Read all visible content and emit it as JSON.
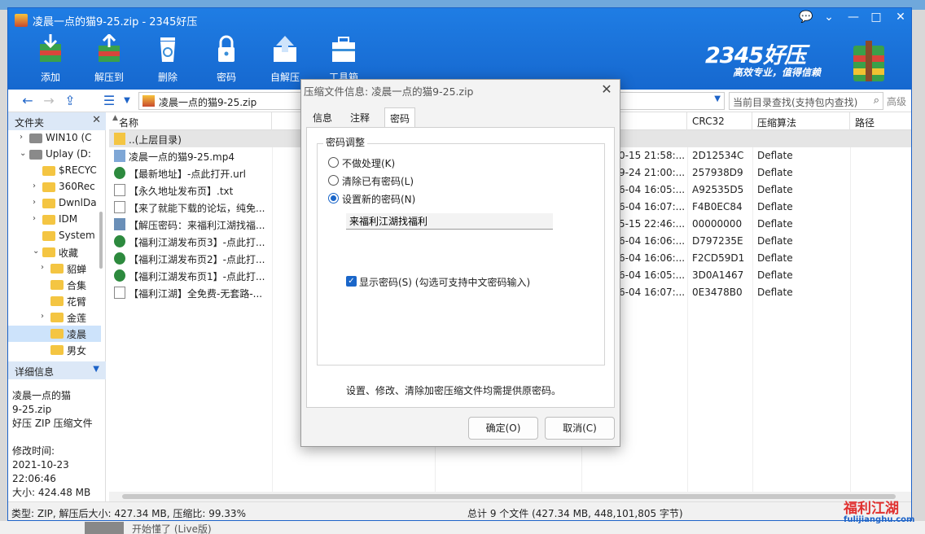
{
  "window": {
    "title": "凌晨一点的猫9-25.zip - 2345好压",
    "controls": {
      "feedback": "💬",
      "menu": "⌄",
      "minimize": "—",
      "maximize": "□",
      "close": "✕"
    }
  },
  "toolbar": {
    "buttons": [
      {
        "label": "添加",
        "icon": "add-archive-icon"
      },
      {
        "label": "解压到",
        "icon": "extract-to-icon"
      },
      {
        "label": "删除",
        "icon": "recycle-bin-icon"
      },
      {
        "label": "密码",
        "icon": "lock-icon"
      },
      {
        "label": "自解压",
        "icon": "self-extract-icon"
      },
      {
        "label": "工具箱",
        "icon": "toolbox-icon"
      }
    ]
  },
  "brand": {
    "logo": "2345好压",
    "slogan": "高效专业，值得信赖"
  },
  "address": {
    "path": "凌晨一点的猫9-25.zip",
    "search_placeholder": "当前目录查找(支持包内查找)",
    "advanced": "高级"
  },
  "left_panel": {
    "header": "文件夹",
    "tree": [
      {
        "label": "WIN10 (C",
        "type": "drive",
        "arrow": "›"
      },
      {
        "label": "Uplay (D:",
        "type": "drive",
        "arrow": "⌄"
      },
      {
        "label": "$RECYC",
        "type": "folder",
        "arrow": ""
      },
      {
        "label": "360Rec",
        "type": "folder",
        "arrow": "›"
      },
      {
        "label": "DwnlDa",
        "type": "folder",
        "arrow": "›"
      },
      {
        "label": "IDM",
        "type": "folder",
        "arrow": "›"
      },
      {
        "label": "System",
        "type": "folder",
        "arrow": ""
      },
      {
        "label": "收藏",
        "type": "folder",
        "arrow": "⌄"
      },
      {
        "label": "貂蝉",
        "type": "folder",
        "arrow": "›"
      },
      {
        "label": "合集",
        "type": "folder",
        "arrow": ""
      },
      {
        "label": "花臂",
        "type": "folder",
        "arrow": ""
      },
      {
        "label": "金莲",
        "type": "folder",
        "arrow": "›"
      },
      {
        "label": "凌晨",
        "type": "folder",
        "arrow": "",
        "selected": true
      },
      {
        "label": "男女",
        "type": "folder",
        "arrow": ""
      }
    ],
    "detail_header": "详细信息",
    "detail": {
      "name": "凌晨一点的猫",
      "name2": "9-25.zip",
      "type": "好压 ZIP 压缩文件",
      "modified_label": "修改时间:",
      "modified_date": "2021-10-23",
      "modified_time": "22:06:46",
      "size": "大小: 424.48 MB"
    }
  },
  "file_list": {
    "columns": [
      "名称",
      "间",
      "CRC32",
      "压缩算法",
      "路径"
    ],
    "rows": [
      {
        "name": "..(上层目录)",
        "icon": "folder-icon",
        "size": "",
        "time": "",
        "crc": "",
        "algo": ""
      },
      {
        "name": "凌晨一点的猫9-25.mp4",
        "icon": "video-file-icon",
        "size": "4",
        "time": "0-15 21:58:...",
        "crc": "2D12534C",
        "algo": "Deflate"
      },
      {
        "name": "【最新地址】-点此打开.url",
        "icon": "globe-icon",
        "size": "",
        "time": "9-24 21:00:...",
        "crc": "257938D9",
        "algo": "Deflate"
      },
      {
        "name": "【永久地址发布页】.txt",
        "icon": "text-file-icon",
        "size": "",
        "time": "6-04 16:05:...",
        "crc": "A92535D5",
        "algo": "Deflate"
      },
      {
        "name": "【来了就能下载的论坛，纯免...",
        "icon": "text-file-icon",
        "size": "",
        "time": "6-04 16:07:...",
        "crc": "F4B0EC84",
        "algo": "Deflate"
      },
      {
        "name": "【解压密码：来福利江湖找福...",
        "icon": "image-file-icon",
        "size": "",
        "time": "5-15 22:46:...",
        "crc": "00000000",
        "algo": "Deflate"
      },
      {
        "name": "【福利江湖发布页3】-点此打...",
        "icon": "globe-icon",
        "size": "",
        "time": "6-04 16:06:...",
        "crc": "D797235E",
        "algo": "Deflate"
      },
      {
        "name": "【福利江湖发布页2】-点此打...",
        "icon": "globe-icon",
        "size": "",
        "time": "6-04 16:06:...",
        "crc": "F2CD59D1",
        "algo": "Deflate"
      },
      {
        "name": "【福利江湖发布页1】-点此打...",
        "icon": "globe-icon",
        "size": "",
        "time": "6-04 16:05:...",
        "crc": "3D0A1467",
        "algo": "Deflate"
      },
      {
        "name": "【福利江湖】全免费-无套路-...",
        "icon": "text-file-icon",
        "size": "",
        "time": "6-04 16:07:...",
        "crc": "0E3478B0",
        "algo": "Deflate"
      }
    ]
  },
  "status": {
    "left": "类型: ZIP, 解压后大小: 427.34 MB, 压缩比: 99.33%",
    "right": "总计 9 个文件 (427.34 MB, 448,101,805 字节)"
  },
  "watermark": {
    "big": "福利江湖",
    "small": "fulijianghu.com"
  },
  "taskbar": {
    "music": "开始懂了 (Live版)"
  },
  "dialog": {
    "title": "压缩文件信息: 凌晨一点的猫9-25.zip",
    "close": "✕",
    "tabs": [
      "信息",
      "注释",
      "密码"
    ],
    "active_tab": 2,
    "group_title": "密码调整",
    "options": [
      "不做处理(K)",
      "清除已有密码(L)",
      "设置新的密码(N)"
    ],
    "selected_option": 2,
    "password_value": "来福利江湖找福利",
    "show_password": "显示密码(S)   (勾选可支持中文密码输入)",
    "note": "设置、修改、清除加密压缩文件均需提供原密码。",
    "ok": "确定(O)",
    "cancel": "取消(C)"
  },
  "colors": {
    "title_blue": "#1d6fd8",
    "accent": "#1a66c9",
    "watermark_red": "#e0302f"
  }
}
